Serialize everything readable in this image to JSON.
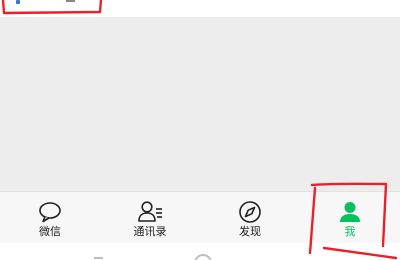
{
  "tabbar": {
    "tabs": [
      {
        "label": "微信",
        "icon": "chat-bubble-icon"
      },
      {
        "label": "通讯录",
        "icon": "contacts-icon"
      },
      {
        "label": "发现",
        "icon": "compass-icon"
      },
      {
        "label": "我",
        "icon": "person-icon",
        "active": true
      }
    ]
  },
  "colors": {
    "accent": "#07c160",
    "annotation": "#e8212c",
    "content_bg": "#ededed",
    "tabbar_bg": "#f7f7f7"
  }
}
